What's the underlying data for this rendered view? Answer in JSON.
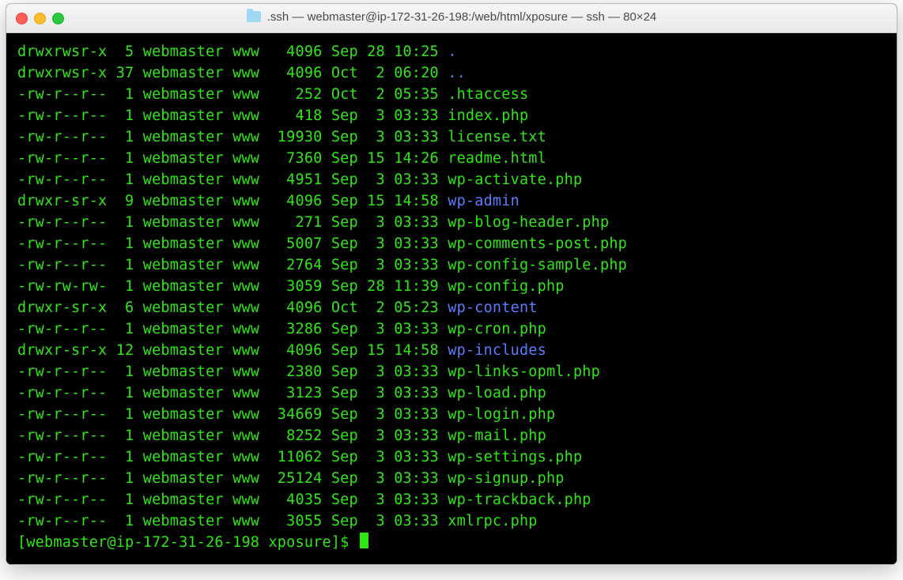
{
  "window": {
    "title": ".ssh — webmaster@ip-172-31-26-198:/web/html/xposure — ssh — 80×24"
  },
  "listing": [
    {
      "perm": "drwxrwsr-x",
      "links": " 5",
      "owner": "webmaster",
      "group": "www",
      "size": "  4096",
      "month": "Sep",
      "day": "28",
      "time": "10:25",
      "name": ".",
      "color": "blue"
    },
    {
      "perm": "drwxrwsr-x",
      "links": "37",
      "owner": "webmaster",
      "group": "www",
      "size": "  4096",
      "month": "Oct",
      "day": " 2",
      "time": "06:20",
      "name": "..",
      "color": "blue"
    },
    {
      "perm": "-rw-r--r--",
      "links": " 1",
      "owner": "webmaster",
      "group": "www",
      "size": "   252",
      "month": "Oct",
      "day": " 2",
      "time": "05:35",
      "name": ".htaccess",
      "color": "green"
    },
    {
      "perm": "-rw-r--r--",
      "links": " 1",
      "owner": "webmaster",
      "group": "www",
      "size": "   418",
      "month": "Sep",
      "day": " 3",
      "time": "03:33",
      "name": "index.php",
      "color": "green"
    },
    {
      "perm": "-rw-r--r--",
      "links": " 1",
      "owner": "webmaster",
      "group": "www",
      "size": " 19930",
      "month": "Sep",
      "day": " 3",
      "time": "03:33",
      "name": "license.txt",
      "color": "green"
    },
    {
      "perm": "-rw-r--r--",
      "links": " 1",
      "owner": "webmaster",
      "group": "www",
      "size": "  7360",
      "month": "Sep",
      "day": "15",
      "time": "14:26",
      "name": "readme.html",
      "color": "green"
    },
    {
      "perm": "-rw-r--r--",
      "links": " 1",
      "owner": "webmaster",
      "group": "www",
      "size": "  4951",
      "month": "Sep",
      "day": " 3",
      "time": "03:33",
      "name": "wp-activate.php",
      "color": "green"
    },
    {
      "perm": "drwxr-sr-x",
      "links": " 9",
      "owner": "webmaster",
      "group": "www",
      "size": "  4096",
      "month": "Sep",
      "day": "15",
      "time": "14:58",
      "name": "wp-admin",
      "color": "blue"
    },
    {
      "perm": "-rw-r--r--",
      "links": " 1",
      "owner": "webmaster",
      "group": "www",
      "size": "   271",
      "month": "Sep",
      "day": " 3",
      "time": "03:33",
      "name": "wp-blog-header.php",
      "color": "green"
    },
    {
      "perm": "-rw-r--r--",
      "links": " 1",
      "owner": "webmaster",
      "group": "www",
      "size": "  5007",
      "month": "Sep",
      "day": " 3",
      "time": "03:33",
      "name": "wp-comments-post.php",
      "color": "green"
    },
    {
      "perm": "-rw-r--r--",
      "links": " 1",
      "owner": "webmaster",
      "group": "www",
      "size": "  2764",
      "month": "Sep",
      "day": " 3",
      "time": "03:33",
      "name": "wp-config-sample.php",
      "color": "green"
    },
    {
      "perm": "-rw-rw-rw-",
      "links": " 1",
      "owner": "webmaster",
      "group": "www",
      "size": "  3059",
      "month": "Sep",
      "day": "28",
      "time": "11:39",
      "name": "wp-config.php",
      "color": "green"
    },
    {
      "perm": "drwxr-sr-x",
      "links": " 6",
      "owner": "webmaster",
      "group": "www",
      "size": "  4096",
      "month": "Oct",
      "day": " 2",
      "time": "05:23",
      "name": "wp-content",
      "color": "blue"
    },
    {
      "perm": "-rw-r--r--",
      "links": " 1",
      "owner": "webmaster",
      "group": "www",
      "size": "  3286",
      "month": "Sep",
      "day": " 3",
      "time": "03:33",
      "name": "wp-cron.php",
      "color": "green"
    },
    {
      "perm": "drwxr-sr-x",
      "links": "12",
      "owner": "webmaster",
      "group": "www",
      "size": "  4096",
      "month": "Sep",
      "day": "15",
      "time": "14:58",
      "name": "wp-includes",
      "color": "blue"
    },
    {
      "perm": "-rw-r--r--",
      "links": " 1",
      "owner": "webmaster",
      "group": "www",
      "size": "  2380",
      "month": "Sep",
      "day": " 3",
      "time": "03:33",
      "name": "wp-links-opml.php",
      "color": "green"
    },
    {
      "perm": "-rw-r--r--",
      "links": " 1",
      "owner": "webmaster",
      "group": "www",
      "size": "  3123",
      "month": "Sep",
      "day": " 3",
      "time": "03:33",
      "name": "wp-load.php",
      "color": "green"
    },
    {
      "perm": "-rw-r--r--",
      "links": " 1",
      "owner": "webmaster",
      "group": "www",
      "size": " 34669",
      "month": "Sep",
      "day": " 3",
      "time": "03:33",
      "name": "wp-login.php",
      "color": "green"
    },
    {
      "perm": "-rw-r--r--",
      "links": " 1",
      "owner": "webmaster",
      "group": "www",
      "size": "  8252",
      "month": "Sep",
      "day": " 3",
      "time": "03:33",
      "name": "wp-mail.php",
      "color": "green"
    },
    {
      "perm": "-rw-r--r--",
      "links": " 1",
      "owner": "webmaster",
      "group": "www",
      "size": " 11062",
      "month": "Sep",
      "day": " 3",
      "time": "03:33",
      "name": "wp-settings.php",
      "color": "green"
    },
    {
      "perm": "-rw-r--r--",
      "links": " 1",
      "owner": "webmaster",
      "group": "www",
      "size": " 25124",
      "month": "Sep",
      "day": " 3",
      "time": "03:33",
      "name": "wp-signup.php",
      "color": "green"
    },
    {
      "perm": "-rw-r--r--",
      "links": " 1",
      "owner": "webmaster",
      "group": "www",
      "size": "  4035",
      "month": "Sep",
      "day": " 3",
      "time": "03:33",
      "name": "wp-trackback.php",
      "color": "green"
    },
    {
      "perm": "-rw-r--r--",
      "links": " 1",
      "owner": "webmaster",
      "group": "www",
      "size": "  3055",
      "month": "Sep",
      "day": " 3",
      "time": "03:33",
      "name": "xmlrpc.php",
      "color": "green"
    }
  ],
  "prompt": "[webmaster@ip-172-31-26-198 xposure]$ "
}
